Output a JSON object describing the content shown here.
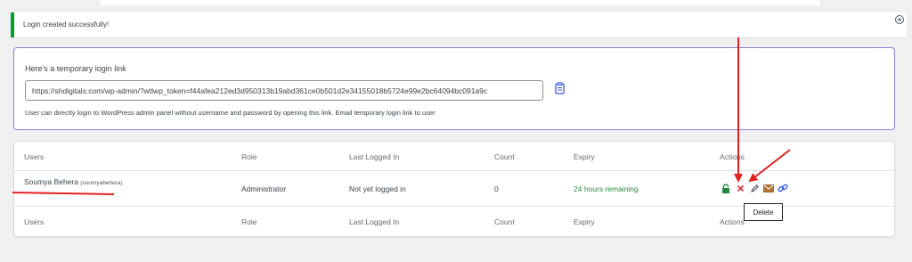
{
  "notice": {
    "message": "Login created successfully!"
  },
  "link_box": {
    "title": "Here's a temporary login link",
    "url": "https://shdigitals.com/wp-admin/?wtlwp_token=f44afea212ed3d950313b19abd361ce0b501d2e34155018b5724e99e2bc64094bc091a9c",
    "description": "User can directly login to WordPress admin panel without username and password by opening this link. Email temporary login link to user"
  },
  "table": {
    "headers": {
      "users": "Users",
      "role": "Role",
      "last_logged_in": "Last Logged In",
      "count": "Count",
      "expiry": "Expiry",
      "actions": "Actions"
    },
    "rows": [
      {
        "name": "Soumya Behera",
        "username": "(soumyabehera)",
        "role": "Administrator",
        "last_logged_in": "Not yet logged in",
        "count": "0",
        "expiry": "24 hours remaining"
      }
    ]
  },
  "tooltip": {
    "text": "Delete"
  },
  "icons": {
    "lock": "lock-icon",
    "delete": "delete-icon",
    "edit": "edit-icon",
    "email": "email-icon",
    "link": "link-icon",
    "clipboard": "clipboard-icon",
    "close": "close-icon"
  },
  "colors": {
    "success": "#00a32a",
    "expiry_text": "#2b8a3e",
    "delete": "#d63638",
    "accent_border": "#8c7cd6",
    "annotation_arrow": "#e12020"
  }
}
